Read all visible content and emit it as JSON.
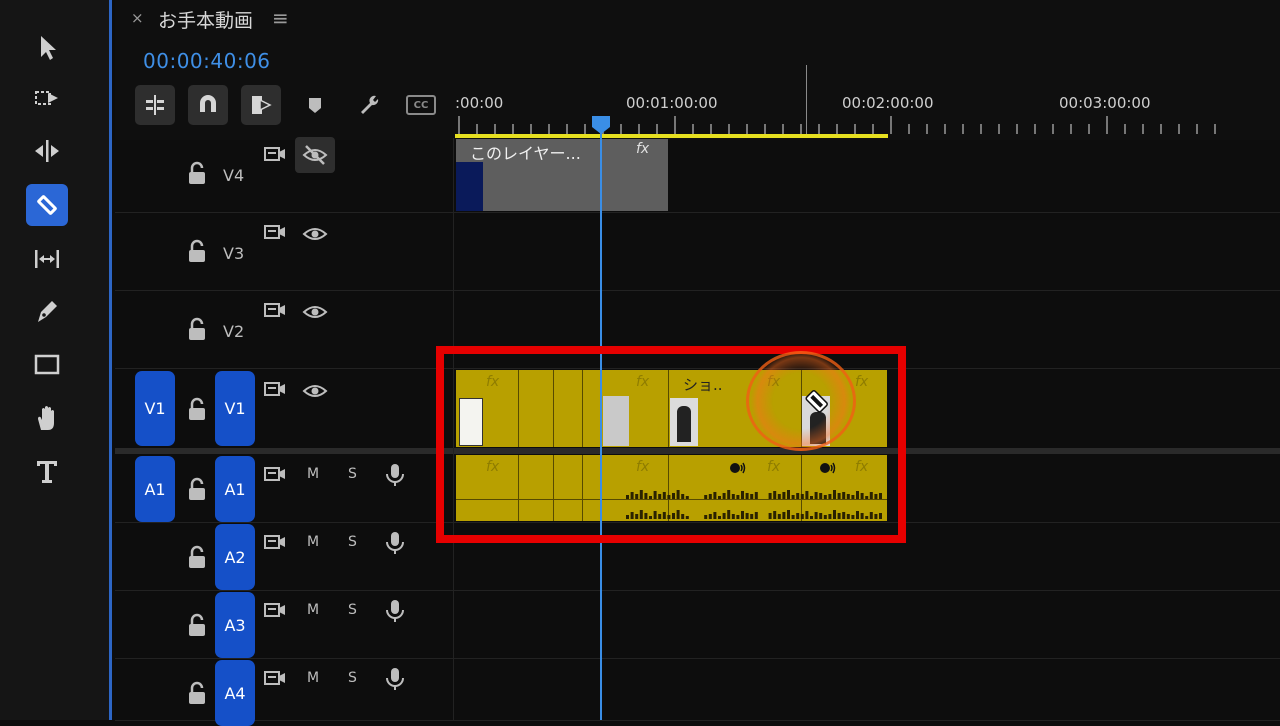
{
  "panel": {
    "close_label": "×",
    "title": "お手本動画",
    "menu_label": "≡",
    "timecode": "00:00:40:06"
  },
  "toolbar": {
    "tools": [
      "selection-tool-icon",
      "track-select-forward-icon",
      "ripple-edit-icon",
      "razor-icon",
      "slip-icon",
      "pen-icon",
      "rectangle-icon",
      "hand-icon",
      "type-icon"
    ],
    "active_tool": "razor-icon"
  },
  "timeline_controls": {
    "cc_label": "CC"
  },
  "ruler": {
    "labels": [
      ":00:00",
      "00:01:00:00",
      "00:02:00:00",
      "00:03:00:00"
    ]
  },
  "tracks": {
    "v4": {
      "name": "V4"
    },
    "v3": {
      "name": "V3"
    },
    "v2": {
      "name": "V2"
    },
    "v1": {
      "source": "V1",
      "name": "V1"
    },
    "a1": {
      "source": "A1",
      "name": "A1",
      "m": "M",
      "s": "S"
    },
    "a2": {
      "name": "A2",
      "m": "M",
      "s": "S"
    },
    "a3": {
      "name": "A3",
      "m": "M",
      "s": "S"
    },
    "a4": {
      "name": "A4",
      "m": "M",
      "s": "S"
    }
  },
  "clips": {
    "v4_clip_title": "このレイヤー...",
    "v1_clip_title": "ショ..",
    "fx_label": "fx"
  },
  "colors": {
    "accent_blue": "#2b67d6",
    "clip_yellow": "#b8a000",
    "highlight_red": "#e60000",
    "timecode_blue": "#3f8fe6"
  }
}
